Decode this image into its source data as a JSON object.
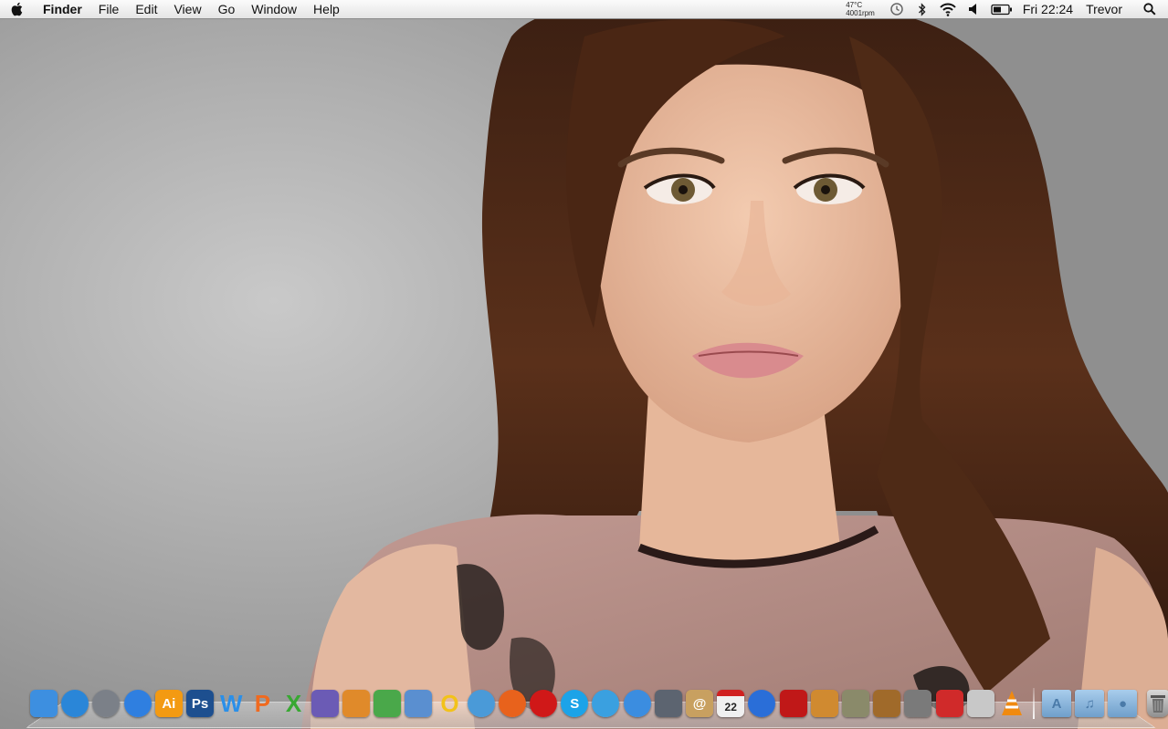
{
  "menubar": {
    "app_name": "Finder",
    "menus": [
      "File",
      "Edit",
      "View",
      "Go",
      "Window",
      "Help"
    ],
    "temp": "47°C",
    "fan": "4001rpm",
    "clock": "Fri 22:24",
    "user": "Trevor"
  },
  "dock": {
    "apps": [
      {
        "name": "finder-icon",
        "label": "",
        "color": "#3d8fe0"
      },
      {
        "name": "globe-icon",
        "label": "",
        "color": "#2a86d8"
      },
      {
        "name": "launchpad-icon",
        "label": "",
        "color": "#7b8088"
      },
      {
        "name": "app-store-icon",
        "label": "",
        "color": "#2f7fe0"
      },
      {
        "name": "illustrator-icon",
        "label": "Ai",
        "color": "#f39a12"
      },
      {
        "name": "photoshop-icon",
        "label": "Ps",
        "color": "#1d4f8f"
      },
      {
        "name": "word-icon",
        "label": "W",
        "color": "#2b8fe8"
      },
      {
        "name": "powerpoint-icon",
        "label": "P",
        "color": "#f06a1f"
      },
      {
        "name": "excel-icon",
        "label": "X",
        "color": "#38a832"
      },
      {
        "name": "pen-tool-icon",
        "label": "",
        "color": "#6b5bb5"
      },
      {
        "name": "keynote-icon",
        "label": "",
        "color": "#e08a2a"
      },
      {
        "name": "numbers-icon",
        "label": "",
        "color": "#4aa84a"
      },
      {
        "name": "preview-icon",
        "label": "",
        "color": "#5a8fd0"
      },
      {
        "name": "outlook-icon",
        "label": "O",
        "color": "#f2c21a"
      },
      {
        "name": "safari-icon",
        "label": "",
        "color": "#4a9ad8"
      },
      {
        "name": "firefox-icon",
        "label": "",
        "color": "#e8621c"
      },
      {
        "name": "opera-icon",
        "label": "",
        "color": "#d01818"
      },
      {
        "name": "skype-icon",
        "label": "S",
        "color": "#1ca3e8"
      },
      {
        "name": "messenger-icon",
        "label": "",
        "color": "#3aa0e0"
      },
      {
        "name": "chat-bubble-icon",
        "label": "",
        "color": "#3b8de0"
      },
      {
        "name": "facetime-camera-icon",
        "label": "",
        "color": "#5c6470"
      },
      {
        "name": "address-book-icon",
        "label": "@",
        "color": "#c8a060"
      },
      {
        "name": "calendar-icon",
        "label": "22",
        "color": "#f0f0f0"
      },
      {
        "name": "itunes-icon",
        "label": "",
        "color": "#2a6ed8"
      },
      {
        "name": "photo-booth-icon",
        "label": "",
        "color": "#c01818"
      },
      {
        "name": "iphoto-icon",
        "label": "",
        "color": "#d08a30"
      },
      {
        "name": "imovie-star-icon",
        "label": "",
        "color": "#8a8a6a"
      },
      {
        "name": "garageband-guitar-icon",
        "label": "",
        "color": "#a06a2a"
      },
      {
        "name": "system-preferences-icon",
        "label": "",
        "color": "#7a7a7a"
      },
      {
        "name": "mail-stamp-icon",
        "label": "",
        "color": "#d02a2a"
      },
      {
        "name": "utility-app-icon",
        "label": "",
        "color": "#c8c8c8"
      },
      {
        "name": "vlc-cone-icon",
        "label": "",
        "color": "#f08a10"
      }
    ],
    "folders": [
      {
        "name": "applications-folder-icon",
        "label": "A"
      },
      {
        "name": "music-folder-icon",
        "label": "♫"
      },
      {
        "name": "downloads-folder-icon",
        "label": "●"
      }
    ]
  }
}
